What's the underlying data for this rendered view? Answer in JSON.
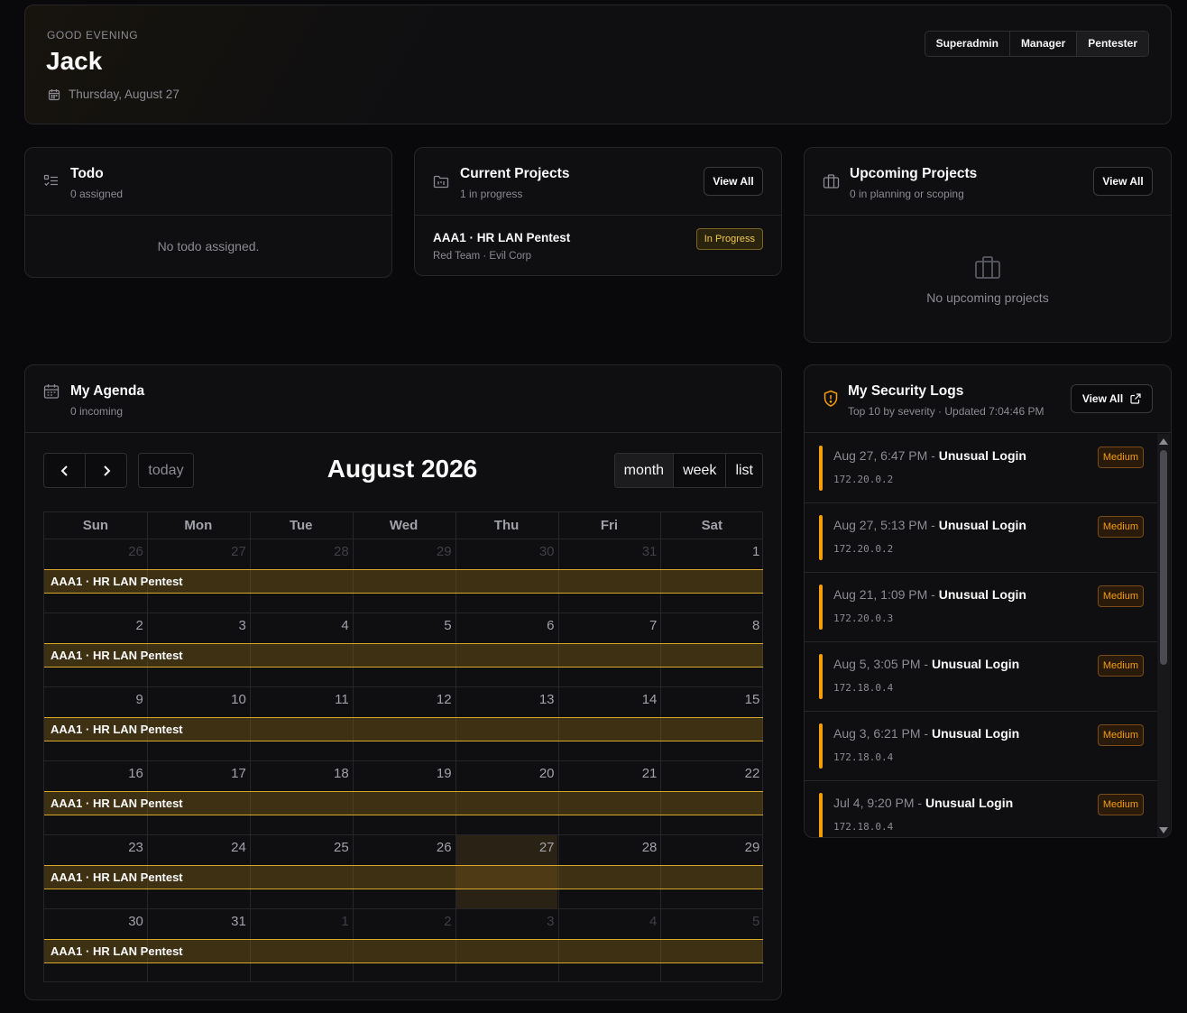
{
  "header": {
    "eyebrow": "GOOD EVENING",
    "name": "Jack",
    "date": "Thursday, August 27",
    "roles": [
      "Superadmin",
      "Manager",
      "Pentester"
    ]
  },
  "todo": {
    "title": "Todo",
    "subtitle": "0 assigned",
    "empty": "No todo assigned."
  },
  "current_projects": {
    "title": "Current Projects",
    "subtitle": "1 in progress",
    "view_all": "View All",
    "items": [
      {
        "name": "AAA1 · HR LAN Pentest",
        "meta": "Red Team · Evil Corp",
        "status": "In Progress"
      }
    ]
  },
  "upcoming_projects": {
    "title": "Upcoming Projects",
    "subtitle": "0 in planning or scoping",
    "view_all": "View All",
    "empty": "No upcoming projects"
  },
  "agenda": {
    "title": "My Agenda",
    "subtitle": "0 incoming",
    "today_label": "today",
    "month_title": "August 2026",
    "views": [
      "month",
      "week",
      "list"
    ],
    "active_view": "month",
    "weekdays": [
      "Sun",
      "Mon",
      "Tue",
      "Wed",
      "Thu",
      "Fri",
      "Sat"
    ],
    "weeks": [
      [
        "26",
        "27",
        "28",
        "29",
        "30",
        "31",
        "1"
      ],
      [
        "2",
        "3",
        "4",
        "5",
        "6",
        "7",
        "8"
      ],
      [
        "9",
        "10",
        "11",
        "12",
        "13",
        "14",
        "15"
      ],
      [
        "16",
        "17",
        "18",
        "19",
        "20",
        "21",
        "22"
      ],
      [
        "23",
        "24",
        "25",
        "26",
        "27",
        "28",
        "29"
      ],
      [
        "30",
        "31",
        "1",
        "2",
        "3",
        "4",
        "5"
      ]
    ],
    "event_label": "AAA1 · HR LAN Pentest",
    "today_date": "27"
  },
  "security_logs": {
    "title": "My Security Logs",
    "subtitle": "Top 10 by severity · Updated 7:04:46 PM",
    "view_all": "View All",
    "items": [
      {
        "when": "Aug 27, 6:47 PM",
        "event": "Unusual Login",
        "ip": "172.20.0.2",
        "severity": "Medium"
      },
      {
        "when": "Aug 27, 5:13 PM",
        "event": "Unusual Login",
        "ip": "172.20.0.2",
        "severity": "Medium"
      },
      {
        "when": "Aug 21, 1:09 PM",
        "event": "Unusual Login",
        "ip": "172.20.0.3",
        "severity": "Medium"
      },
      {
        "when": "Aug 5, 3:05 PM",
        "event": "Unusual Login",
        "ip": "172.18.0.4",
        "severity": "Medium"
      },
      {
        "when": "Aug 3, 6:21 PM",
        "event": "Unusual Login",
        "ip": "172.18.0.4",
        "severity": "Medium"
      },
      {
        "when": "Jul 4, 9:20 PM",
        "event": "Unusual Login",
        "ip": "172.18.0.4",
        "severity": "Medium"
      }
    ]
  },
  "colors": {
    "accent": "#f59e0b",
    "event_border": "#d7a92a",
    "background": "#09090b"
  }
}
